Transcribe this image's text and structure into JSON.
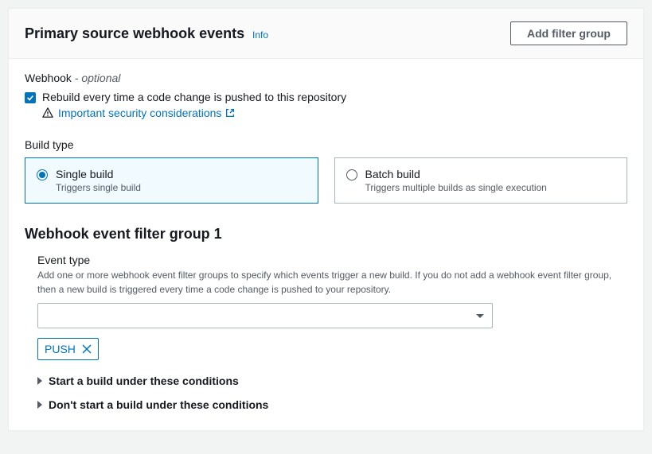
{
  "header": {
    "title": "Primary source webhook events",
    "info_link": "Info",
    "add_button": "Add filter group"
  },
  "webhook": {
    "label": "Webhook",
    "optional": "- optional",
    "checkbox_label": "Rebuild every time a code change is pushed to this repository",
    "security_link": "Important security considerations"
  },
  "build_type": {
    "label": "Build type",
    "options": [
      {
        "title": "Single build",
        "desc": "Triggers single build"
      },
      {
        "title": "Batch build",
        "desc": "Triggers multiple builds as single execution"
      }
    ]
  },
  "filter_group": {
    "heading": "Webhook event filter group 1",
    "event_type_label": "Event type",
    "event_type_desc": "Add one or more webhook event filter groups to specify which events trigger a new build. If you do not add a webhook event filter group, then a new build is triggered every time a code change is pushed to your repository.",
    "tag": "PUSH",
    "expand_start": "Start a build under these conditions",
    "expand_dont_start": "Don't start a build under these conditions"
  }
}
